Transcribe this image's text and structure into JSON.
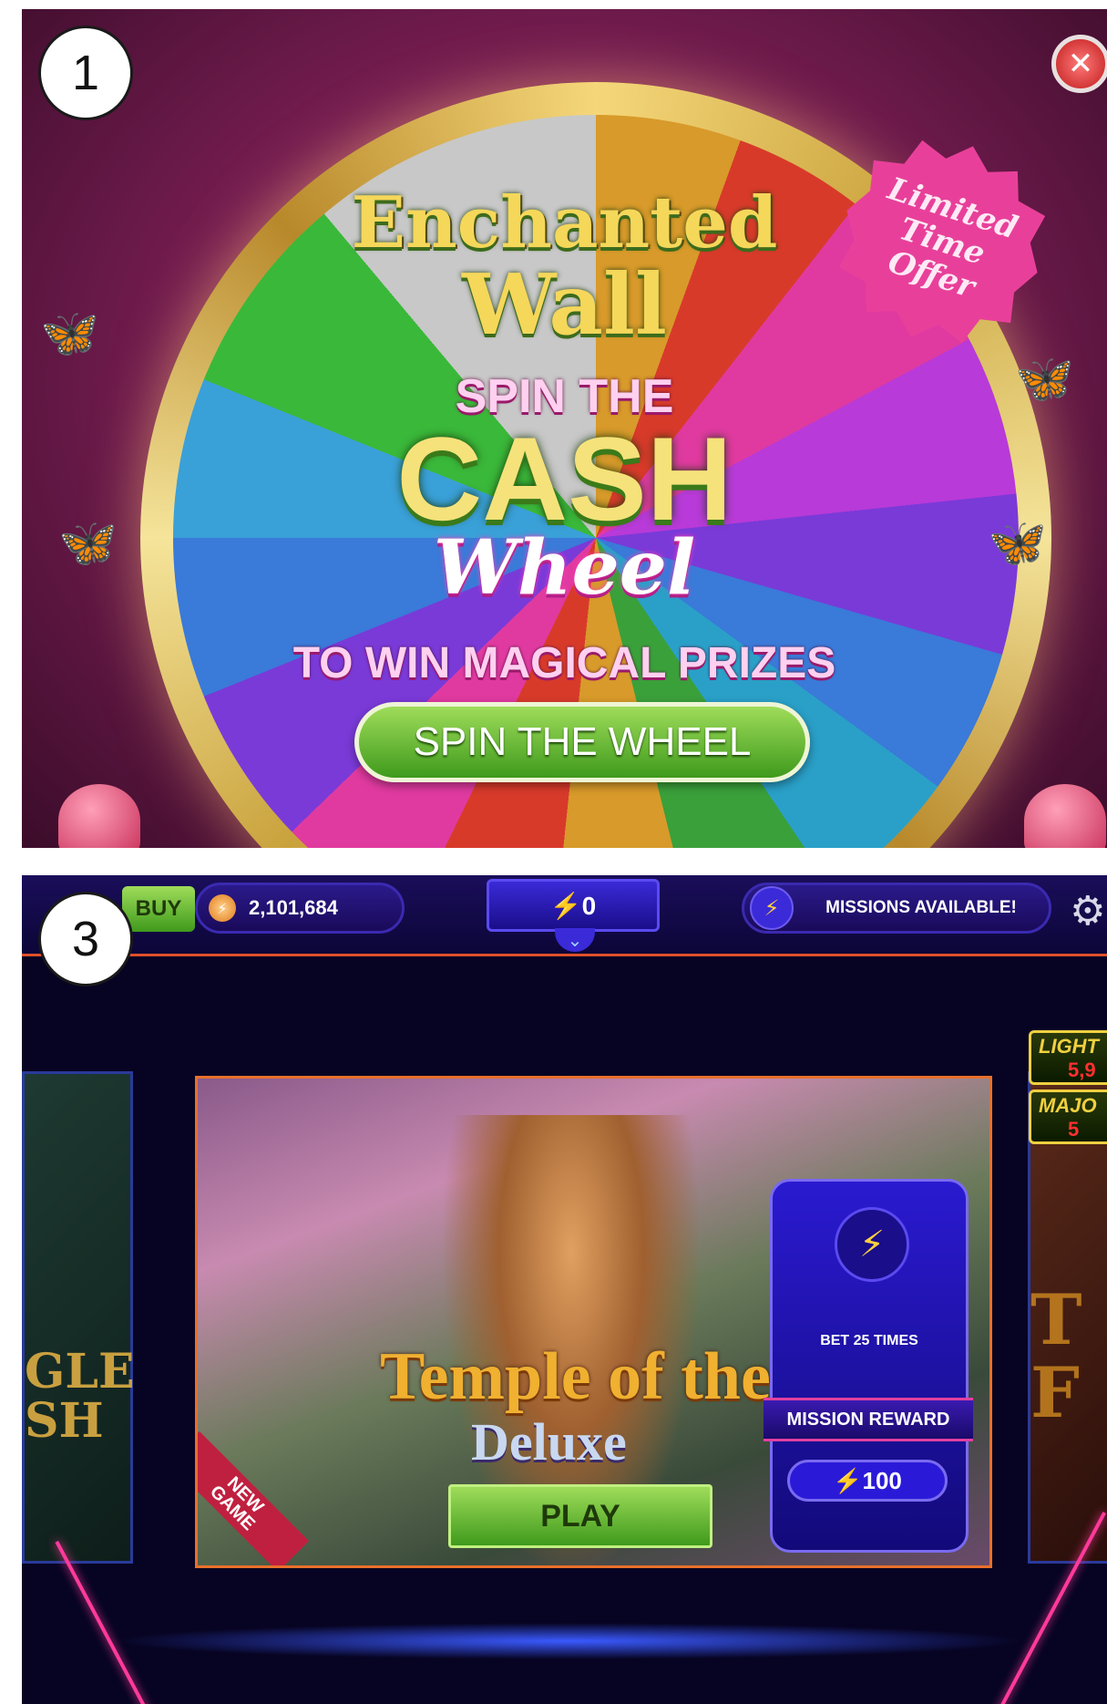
{
  "panel1": {
    "step_number": "1",
    "game_title_line1": "Enchanted",
    "game_title_line2": "Wall",
    "headline_top": "SPIN THE",
    "headline_cash": "CASH",
    "headline_wheel": "Wheel",
    "subheadline": "TO WIN MAGICAL PRIZES",
    "cta_button": "SPIN THE WHEEL",
    "offer_badge": "Limited\nTime Offer",
    "close_icon": "close-icon"
  },
  "panel3": {
    "step_number": "3",
    "topbar": {
      "buy_label": "BUY",
      "coin_balance": "2,101,684",
      "energy_value": "⚡0",
      "missions_label": "MISSIONS AVAILABLE!",
      "settings_icon": "gear-icon"
    },
    "left_card_text": "GLE\nSH",
    "right_card_text": "T\nF",
    "jackpots": [
      {
        "label": "LIGHT",
        "value": "5,9"
      },
      {
        "label": "MAJO",
        "value": "5"
      }
    ],
    "featured_game": {
      "title_main": "Temple of the Tiger",
      "title_sub": "Deluxe",
      "play_label": "PLAY",
      "new_badge": "NEW\nGAME"
    },
    "mission": {
      "task": "BET 25 TIMES",
      "reward_label": "MISSION REWARD",
      "reward_value": "⚡100"
    }
  },
  "colors": {
    "panel1_bg": "#7c1f55",
    "panel3_bg": "#070423",
    "green_button": "#3f9a1c",
    "accent_purple": "#2a1ad0",
    "accent_pink": "#e8409a"
  }
}
